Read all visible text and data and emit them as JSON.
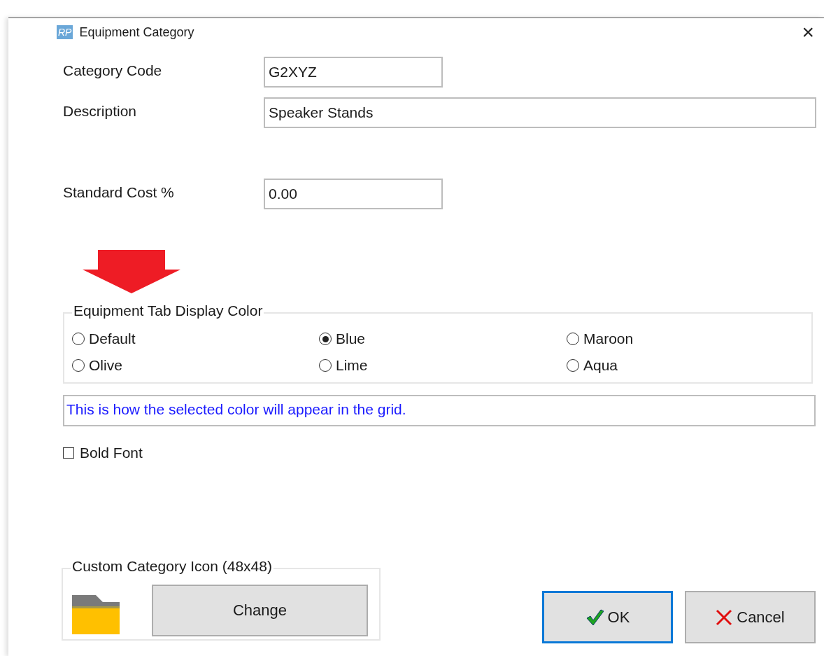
{
  "window": {
    "title": "Equipment Category",
    "logo": "RP",
    "close": "×"
  },
  "fields": [
    {
      "label": "Category Code",
      "value": "G2XYZ",
      "kind": "short"
    },
    {
      "label": "Description",
      "value": "Speaker Stands",
      "kind": "wide"
    },
    {
      "label": "Standard Cost %",
      "value": "0.00",
      "kind": "short"
    }
  ],
  "color_group": {
    "legend": "Equipment Tab Display Color",
    "options": [
      {
        "label": "Default",
        "selected": false
      },
      {
        "label": "Blue",
        "selected": true
      },
      {
        "label": "Maroon",
        "selected": false
      },
      {
        "label": "Olive",
        "selected": false
      },
      {
        "label": "Lime",
        "selected": false
      },
      {
        "label": "Aqua",
        "selected": false
      }
    ],
    "preview": "This is how the selected color will appear in the grid."
  },
  "bold_font": {
    "label": "Bold Font",
    "checked": false
  },
  "icon_group": {
    "legend": "Custom Category Icon (48x48)",
    "button": "Change"
  },
  "buttons": [
    {
      "label": "OK",
      "kind": "ok",
      "focused": true
    },
    {
      "label": "Cancel",
      "kind": "cancel",
      "focused": false
    }
  ]
}
